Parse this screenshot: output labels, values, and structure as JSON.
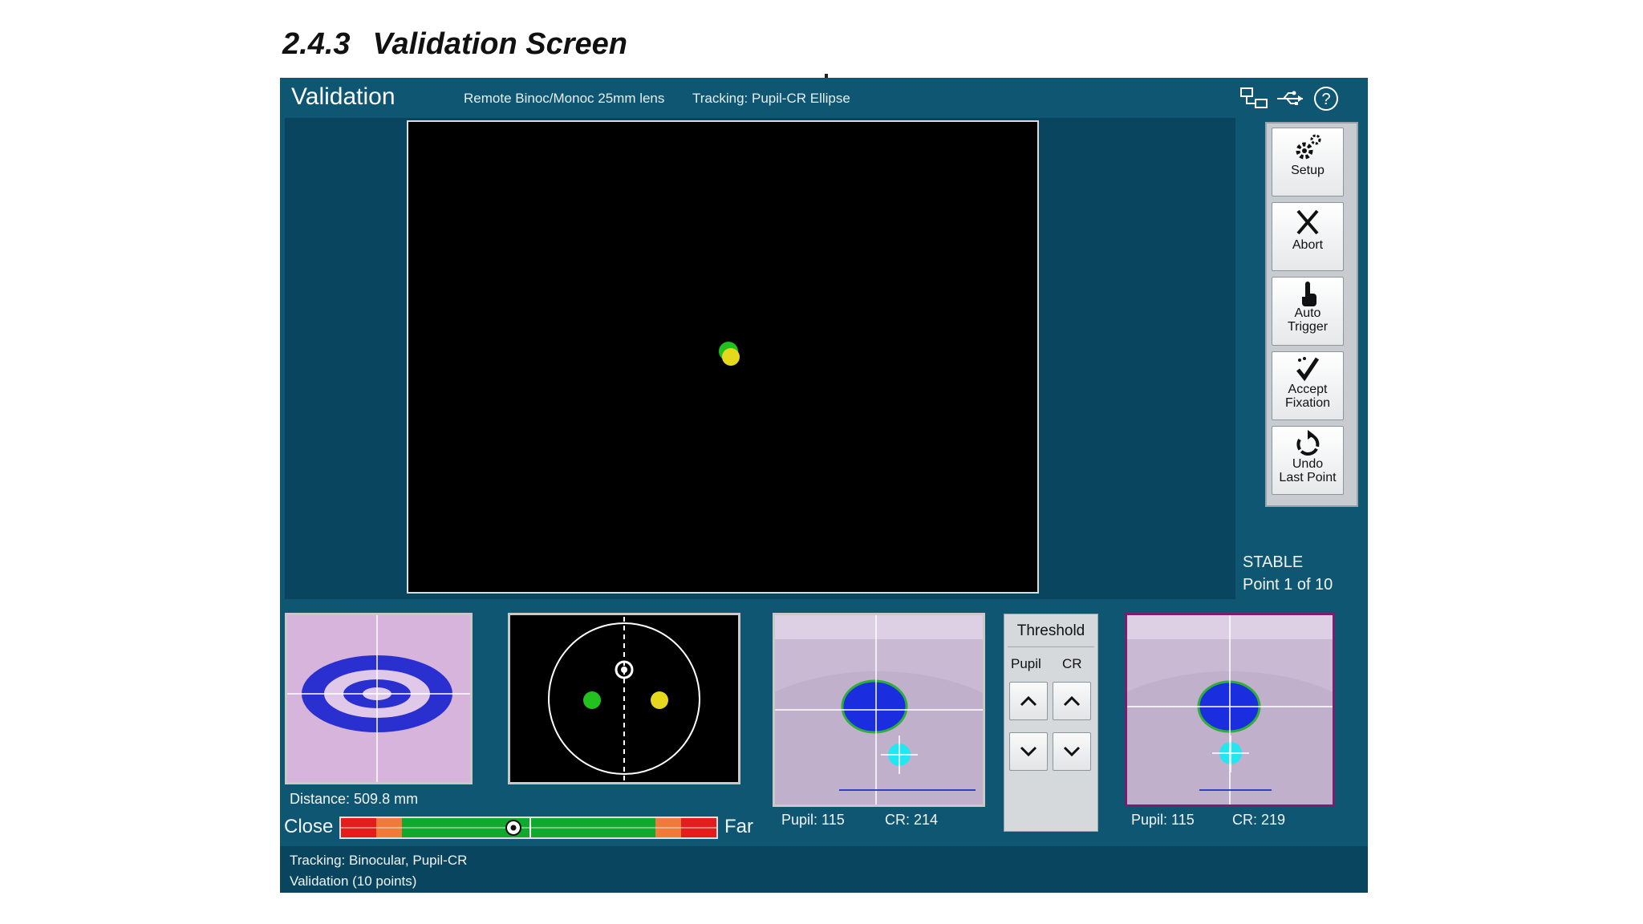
{
  "doc": {
    "section_number": "2.4.3",
    "section_title": "Validation Screen"
  },
  "header": {
    "title": "Validation",
    "lens": "Remote Binoc/Monoc 25mm lens",
    "tracking_mode": "Tracking: Pupil-CR Ellipse",
    "icons": [
      "network-icon",
      "usb-icon",
      "help-icon"
    ]
  },
  "toolbar": {
    "setup": "Setup",
    "abort": "Abort",
    "auto_trigger_1": "Auto",
    "auto_trigger_2": "Trigger",
    "accept_1": "Accept",
    "accept_2": "Fixation",
    "undo_1": "Undo",
    "undo_2": "Last Point"
  },
  "status": {
    "state": "STABLE",
    "point": "Point 1 of 10"
  },
  "distance": {
    "label": "Distance:  509.8 mm",
    "close": "Close",
    "far": "Far",
    "level": 0.46
  },
  "eye_left": {
    "pupil": "Pupil: 115",
    "cr": "CR: 214"
  },
  "eye_right": {
    "pupil": "Pupil: 115",
    "cr": "CR: 219"
  },
  "threshold": {
    "title": "Threshold",
    "pupil": "Pupil",
    "cr": "CR"
  },
  "footer": {
    "line1": "Tracking: Binocular, Pupil-CR",
    "line2": "Validation (10 points)"
  },
  "colors": {
    "background": "#0e5672",
    "left_gaze": "#22c11e",
    "right_gaze": "#e6d81c",
    "pupil": "#1a2ee0",
    "cr": "#22e6f0"
  }
}
